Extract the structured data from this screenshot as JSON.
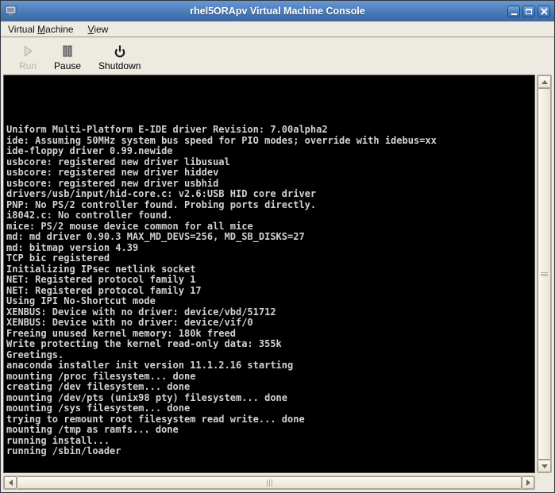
{
  "window": {
    "title": "rhel5ORApv Virtual Machine Console"
  },
  "menubar": {
    "items": [
      {
        "pre": "Virtual ",
        "mnemonic": "M",
        "post": "achine"
      },
      {
        "pre": "",
        "mnemonic": "V",
        "post": "iew"
      }
    ]
  },
  "toolbar": {
    "buttons": [
      {
        "label": "Run",
        "disabled": true
      },
      {
        "label": "Pause",
        "disabled": false
      },
      {
        "label": "Shutdown",
        "disabled": false
      }
    ]
  },
  "console": {
    "lines": [
      "Uniform Multi-Platform E-IDE driver Revision: 7.00alpha2",
      "ide: Assuming 50MHz system bus speed for PIO modes; override with idebus=xx",
      "ide-floppy driver 0.99.newide",
      "usbcore: registered new driver libusual",
      "usbcore: registered new driver hiddev",
      "usbcore: registered new driver usbhid",
      "drivers/usb/input/hid-core.c: v2.6:USB HID core driver",
      "PNP: No PS/2 controller found. Probing ports directly.",
      "i8042.c: No controller found.",
      "mice: PS/2 mouse device common for all mice",
      "md: md driver 0.90.3 MAX_MD_DEVS=256, MD_SB_DISKS=27",
      "md: bitmap version 4.39",
      "TCP bic registered",
      "Initializing IPsec netlink socket",
      "NET: Registered protocol family 1",
      "NET: Registered protocol family 17",
      "Using IPI No-Shortcut mode",
      "XENBUS: Device with no driver: device/vbd/51712",
      "XENBUS: Device with no driver: device/vif/0",
      "Freeing unused kernel memory: 180k freed",
      "Write protecting the kernel read-only data: 355k",
      "Greetings.",
      "anaconda installer init version 11.1.2.16 starting",
      "mounting /proc filesystem... done",
      "creating /dev filesystem... done",
      "mounting /dev/pts (unix98 pty) filesystem... done",
      "mounting /sys filesystem... done",
      "trying to remount root filesystem read write... done",
      "mounting /tmp as ramfs... done",
      "running install...",
      "running /sbin/loader"
    ]
  },
  "icons": {
    "window_icon": "vm-monitor",
    "run": "play-triangle",
    "pause": "double-bars",
    "shutdown": "power-symbol",
    "minimize": "horizontal-bar",
    "maximize": "square-outline",
    "close": "x-cross",
    "scrollbar_arrows": "small-triangles"
  },
  "colors": {
    "titlebar_blue": "#4c7fbe",
    "titlebar_button_blue": "#4c7fbc",
    "panel_beige": "#edeae2",
    "console_bg": "#000000",
    "console_text": "#d2d2d2",
    "disabled_text": "#b7b3aa",
    "scrollbar_trough": "#efe9de"
  }
}
